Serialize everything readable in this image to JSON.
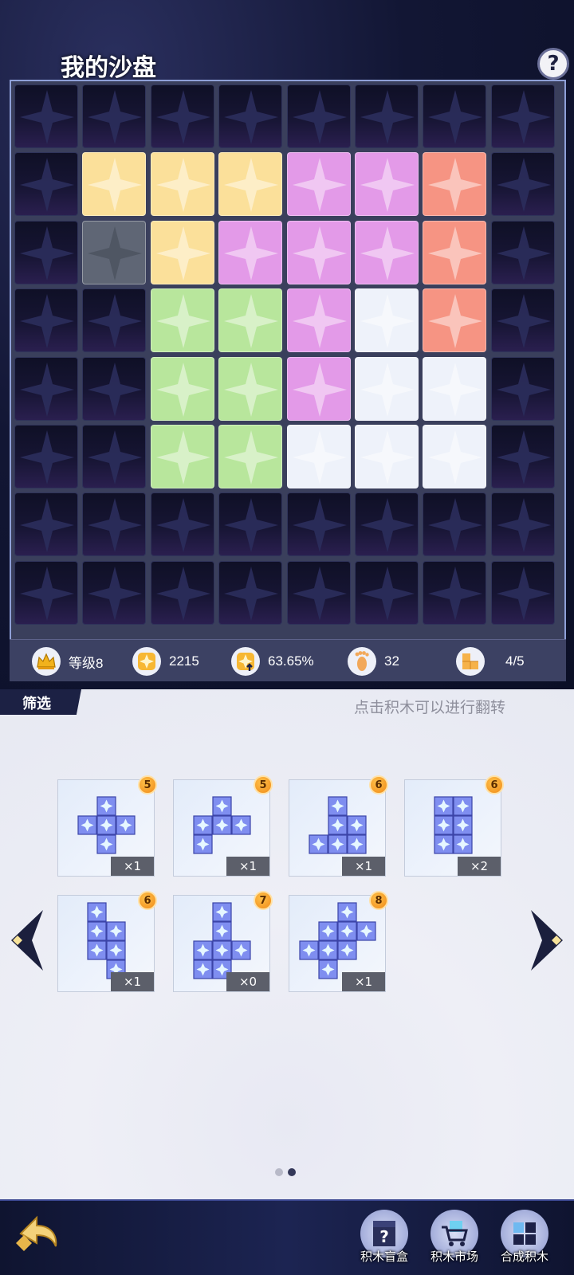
{
  "title": "我的沙盘",
  "help_label": "?",
  "board": {
    "rows": 8,
    "cols": 8,
    "colors": {
      "empty": "#1a1838",
      "gray": "#5f6675",
      "yellow": "#fbe09a",
      "pink": "#e39ae8",
      "salmon": "#f69483",
      "green": "#b8e69c",
      "white": "#eef2fa"
    },
    "cells": [
      [
        "empty",
        "empty",
        "empty",
        "empty",
        "empty",
        "empty",
        "empty",
        "empty"
      ],
      [
        "empty",
        "yellow",
        "yellow",
        "yellow",
        "pink",
        "pink",
        "salmon",
        "empty"
      ],
      [
        "empty",
        "gray",
        "yellow",
        "pink",
        "pink",
        "pink",
        "salmon",
        "empty"
      ],
      [
        "empty",
        "empty",
        "green",
        "green",
        "pink",
        "white",
        "salmon",
        "empty"
      ],
      [
        "empty",
        "empty",
        "green",
        "green",
        "pink",
        "white",
        "white",
        "empty"
      ],
      [
        "empty",
        "empty",
        "green",
        "green",
        "white",
        "white",
        "white",
        "empty"
      ],
      [
        "empty",
        "empty",
        "empty",
        "empty",
        "empty",
        "empty",
        "empty",
        "empty"
      ],
      [
        "empty",
        "empty",
        "empty",
        "empty",
        "empty",
        "empty",
        "empty",
        "empty"
      ]
    ]
  },
  "stats": {
    "level": "等级8",
    "points": "2215",
    "ratio": "63.65%",
    "steps": "32",
    "pieces": "4/5",
    "icons": [
      "crown-icon",
      "diamond-icon",
      "diamond-up-icon",
      "footprint-icon",
      "blocks-icon"
    ]
  },
  "filter_label": "筛选",
  "hint": "点击积木可以进行翻转",
  "pieces": [
    {
      "badge": "5",
      "count": "×1",
      "shape": [
        [
          1,
          0
        ],
        [
          0,
          1
        ],
        [
          1,
          1
        ],
        [
          2,
          1
        ],
        [
          1,
          2
        ]
      ]
    },
    {
      "badge": "5",
      "count": "×1",
      "shape": [
        [
          1,
          0
        ],
        [
          0,
          1
        ],
        [
          1,
          1
        ],
        [
          2,
          1
        ],
        [
          0,
          2
        ]
      ]
    },
    {
      "badge": "6",
      "count": "×1",
      "shape": [
        [
          1,
          0
        ],
        [
          1,
          1
        ],
        [
          2,
          1
        ],
        [
          1,
          2
        ],
        [
          2,
          2
        ],
        [
          0,
          2
        ]
      ]
    },
    {
      "badge": "6",
      "count": "×2",
      "shape": [
        [
          0,
          0
        ],
        [
          1,
          0
        ],
        [
          0,
          1
        ],
        [
          1,
          1
        ],
        [
          0,
          2
        ],
        [
          1,
          2
        ]
      ]
    },
    {
      "badge": "6",
      "count": "×1",
      "shape": [
        [
          0,
          0
        ],
        [
          0,
          1
        ],
        [
          1,
          1
        ],
        [
          0,
          2
        ],
        [
          1,
          2
        ],
        [
          1,
          3
        ]
      ]
    },
    {
      "badge": "7",
      "count": "×0",
      "shape": [
        [
          1,
          0
        ],
        [
          1,
          1
        ],
        [
          0,
          2
        ],
        [
          1,
          2
        ],
        [
          2,
          2
        ],
        [
          0,
          3
        ],
        [
          1,
          3
        ]
      ]
    },
    {
      "badge": "8",
      "count": "×1",
      "shape": [
        [
          2,
          0
        ],
        [
          1,
          1
        ],
        [
          2,
          1
        ],
        [
          3,
          1
        ],
        [
          0,
          2
        ],
        [
          1,
          2
        ],
        [
          2,
          2
        ],
        [
          1,
          3
        ]
      ]
    }
  ],
  "page_dots": [
    false,
    true
  ],
  "nav": {
    "blind_box": "积木盲盒",
    "market": "积木市场",
    "combine": "合成积木"
  }
}
